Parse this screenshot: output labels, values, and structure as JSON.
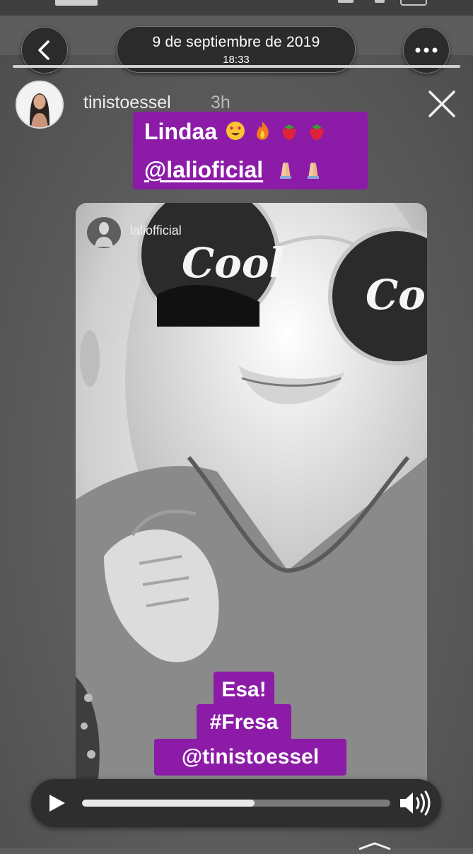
{
  "header": {
    "date": "9 de septiembre de 2019",
    "time": "18:33"
  },
  "user": {
    "username": "tinistoesse l",
    "age": "3h"
  },
  "stickers": {
    "top_line1_text": "Lindaa",
    "top_line2_mention": "@laliofficial",
    "bottom": [
      "Esa!",
      "#Fresa",
      "@tinistoessel"
    ]
  },
  "shared_post": {
    "username": "laliofficial",
    "lens_text": "Cool"
  },
  "player": {
    "progress": 0.56
  },
  "icons": {
    "back": "chevron-left-icon",
    "more": "more-icon",
    "close": "close-icon",
    "play": "play-icon",
    "volume": "volume-icon"
  },
  "colors": {
    "sticker": "#8c1ca8",
    "pill_bg": "#2b2b2b"
  }
}
